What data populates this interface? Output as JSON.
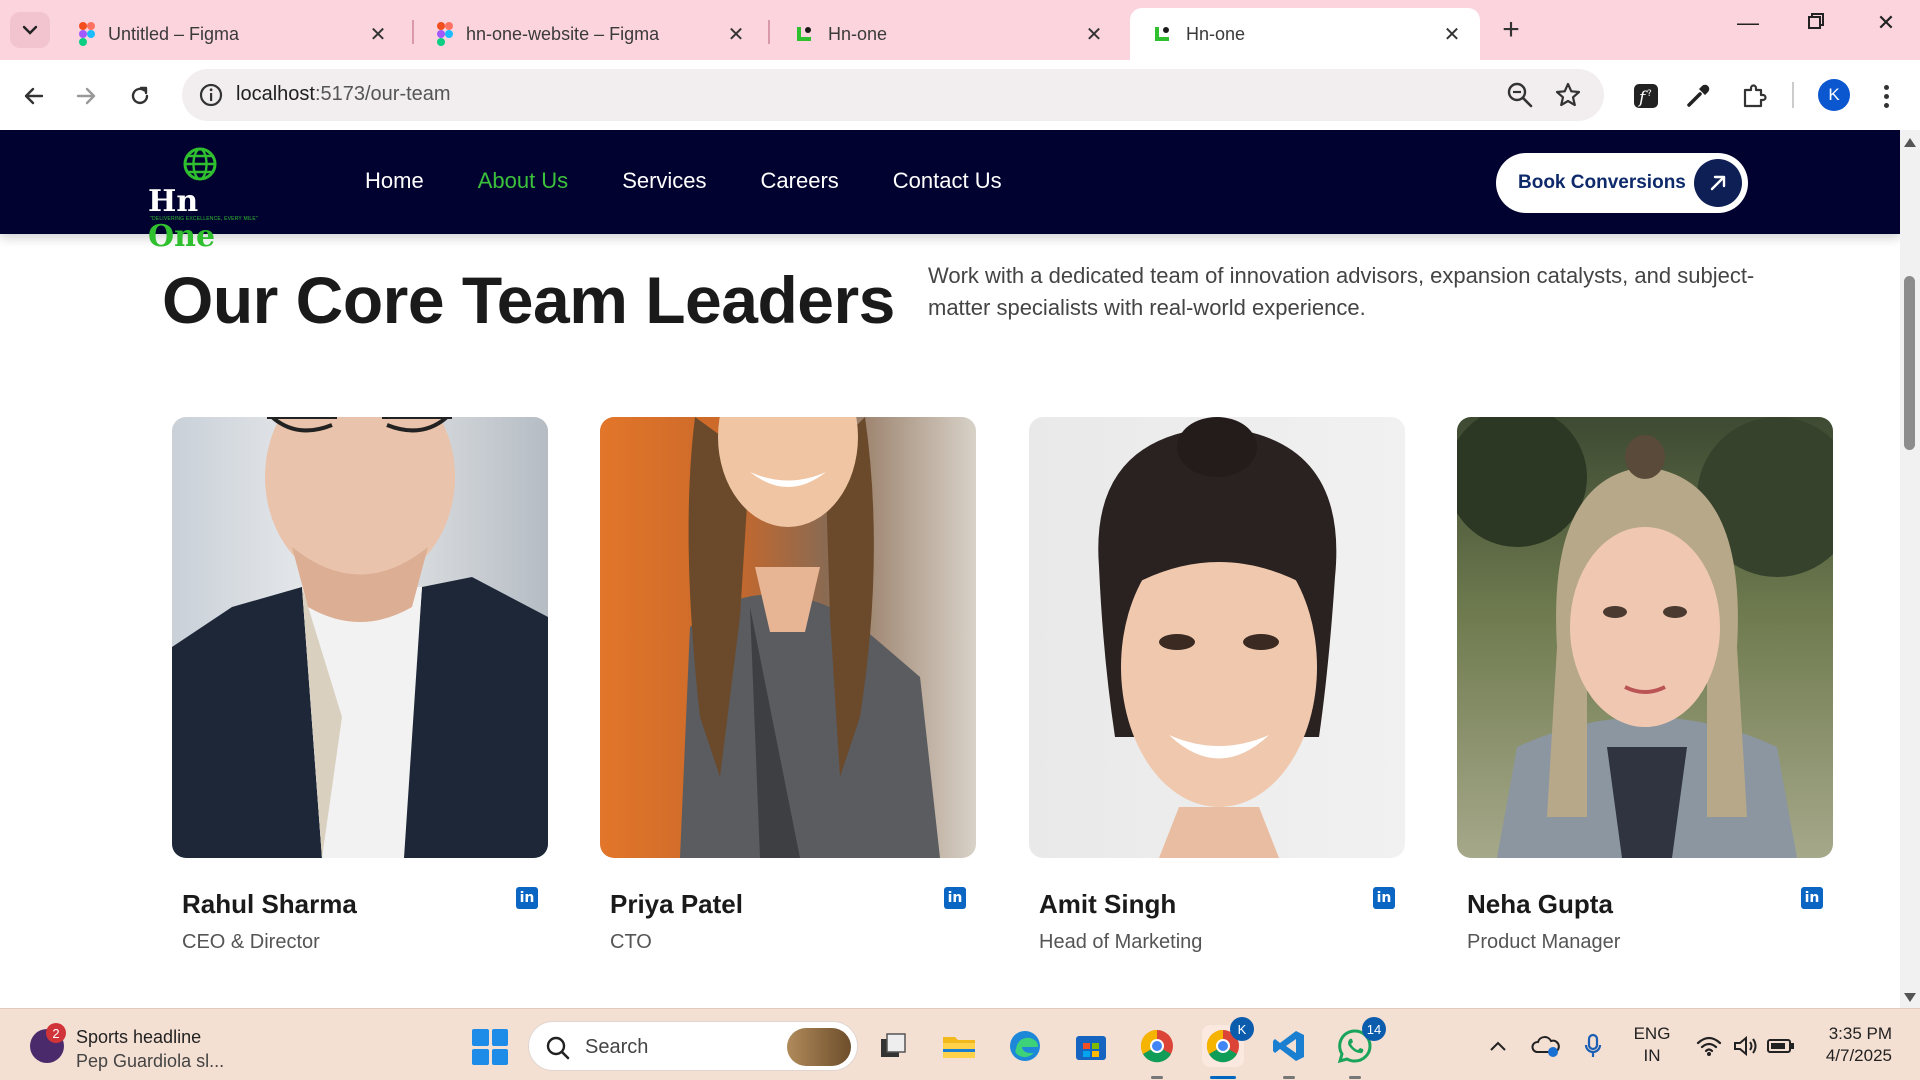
{
  "browser": {
    "tabs": [
      {
        "title": "Untitled – Figma",
        "icon": "figma-icon"
      },
      {
        "title": "hn-one-website – Figma",
        "icon": "figma-icon"
      },
      {
        "title": "Hn-one",
        "icon": "site-favicon"
      },
      {
        "title": "Hn-one",
        "icon": "site-favicon",
        "active": true
      }
    ],
    "url_host": "localhost",
    "url_path": ":5173/our-team",
    "profile_initial": "K"
  },
  "site": {
    "logo": {
      "brand_white": "Hn ",
      "brand_green": "One",
      "tagline": "\"DELIVERING EXCELLENCE, EVERY MILE\""
    },
    "nav": [
      {
        "label": "Home"
      },
      {
        "label": "About Us",
        "active": true
      },
      {
        "label": "Services"
      },
      {
        "label": "Careers"
      },
      {
        "label": "Contact Us"
      }
    ],
    "cta_label": "Book Conversions",
    "colors": {
      "header_bg": "#020230",
      "accent_green": "#3cc13c",
      "cta_navy": "#0e1f55",
      "linkedin": "#0a66c2"
    }
  },
  "team": {
    "title": "Our Core Team Leaders",
    "description": "Work with a dedicated team of innovation advisors, expansion catalysts, and subject-matter specialists with real-world experience.",
    "members": [
      {
        "name": "Rahul Sharma",
        "role": "CEO & Director"
      },
      {
        "name": "Priya Patel",
        "role": "CTO"
      },
      {
        "name": "Amit Singh",
        "role": "Head of Marketing"
      },
      {
        "name": "Neha Gupta",
        "role": "Product Manager"
      }
    ],
    "linkedin_glyph": "in"
  },
  "taskbar": {
    "widget_badge": "2",
    "widget_title": "Sports headline",
    "widget_sub": "Pep Guardiola sl...",
    "search_label": "Search",
    "chrome_badge": "K",
    "whatsapp_badge": "14",
    "lang_line1": "ENG",
    "lang_line2": "IN",
    "time": "3:35 PM",
    "date": "4/7/2025"
  }
}
